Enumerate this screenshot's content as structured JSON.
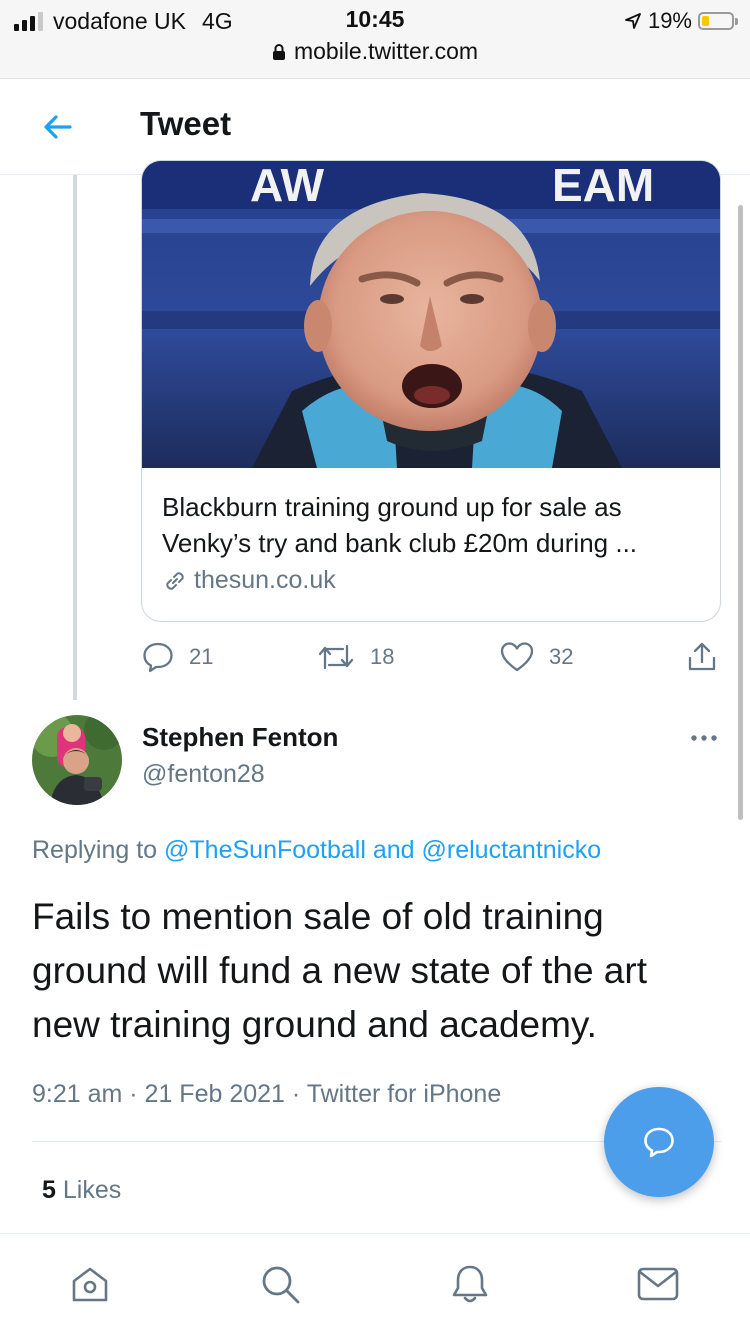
{
  "status_bar": {
    "carrier": "vodafone UK",
    "network": "4G",
    "time": "10:45",
    "battery": "19%",
    "url": "mobile.twitter.com"
  },
  "header": {
    "title": "Tweet"
  },
  "link_card": {
    "title_line1": "Blackburn training ground up for sale as",
    "title_line2": "Venky’s try and bank club £20m during ...",
    "domain": "thesun.co.uk"
  },
  "actions": {
    "replies": "21",
    "retweets": "18",
    "likes": "32"
  },
  "reply": {
    "author_name": "Stephen Fenton",
    "author_handle": "@fenton28",
    "replying_prefix": "Replying to",
    "replying_to": "@TheSunFootball and @reluctantnicko",
    "text_lines": [
      "Fails to mention sale of old training",
      "ground will fund a new state of the art",
      "new training ground and academy."
    ],
    "meta": "9:21 am · 21 Feb 2021 · Twitter for iPhone",
    "likes_count": "5",
    "likes_label": "Likes"
  },
  "icons": {
    "back": "arrow-left-icon",
    "lock": "lock-icon",
    "link": "link-icon",
    "reply": "comment-icon",
    "retweet": "retweet-icon",
    "like": "heart-icon",
    "share": "share-icon",
    "more": "more-icon",
    "compose": "compose-reply-icon",
    "tabs": [
      "home-icon",
      "search-icon",
      "bell-icon",
      "mail-icon"
    ]
  },
  "colors": {
    "accent": "#1da1f2",
    "fab": "#4c9eeb",
    "secondary_text": "#657786"
  }
}
